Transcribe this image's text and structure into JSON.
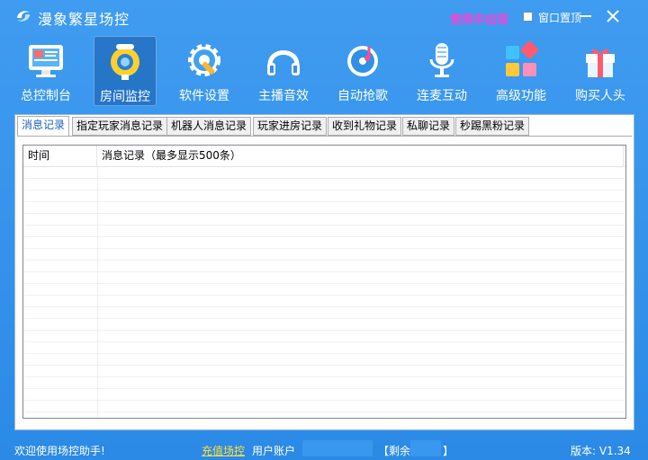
{
  "window": {
    "title": "漫象繁星场控",
    "mode_text": "使用中出现",
    "pin_label": "窗口置顶"
  },
  "toolbar": {
    "items": [
      {
        "label": "总控制台",
        "icon": "dashboard-icon"
      },
      {
        "label": "房间监控",
        "icon": "camera-icon",
        "active": true
      },
      {
        "label": "软件设置",
        "icon": "gear-wrench-icon"
      },
      {
        "label": "主播音效",
        "icon": "headphones-icon"
      },
      {
        "label": "自动抢歌",
        "icon": "music-disc-icon"
      },
      {
        "label": "连麦互动",
        "icon": "microphone-icon"
      },
      {
        "label": "高级功能",
        "icon": "tiles-icon"
      },
      {
        "label": "购买人头",
        "icon": "gift-icon"
      }
    ]
  },
  "tabs": [
    {
      "label": "消息记录",
      "active": true
    },
    {
      "label": "指定玩家消息记录"
    },
    {
      "label": "机器人消息记录"
    },
    {
      "label": "玩家进房记录"
    },
    {
      "label": "收到礼物记录"
    },
    {
      "label": "私聊记录"
    },
    {
      "label": "秒踢黑粉记录"
    }
  ],
  "list": {
    "columns": [
      "时间",
      "消息记录（最多显示500条）"
    ],
    "rows": []
  },
  "statusbar": {
    "welcome": "欢迎使用场控助手!",
    "recharge": "充值场控",
    "account_label": "用户账户",
    "remaining_open": "【剩余",
    "remaining_close": "】",
    "version": "版本: V1.34"
  },
  "colors": {
    "accent": "#2b8ae6",
    "mode_text": "#ff3fd6",
    "recharge": "#ffe03a"
  }
}
